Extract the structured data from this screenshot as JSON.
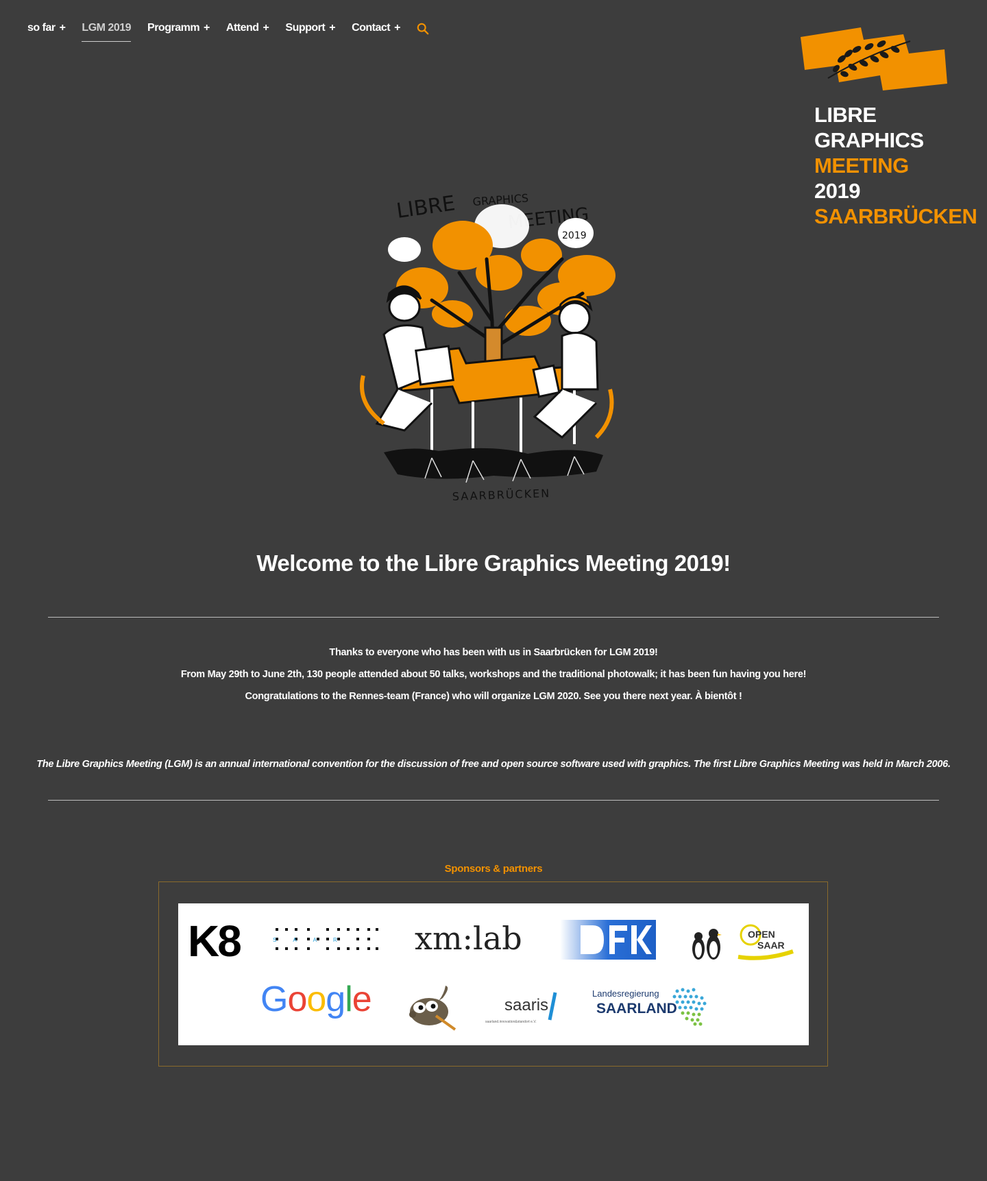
{
  "nav": {
    "items": [
      {
        "label": "so far",
        "plus": "+"
      },
      {
        "label": "LGM 2019",
        "plus": ""
      },
      {
        "label": "Programm",
        "plus": "+"
      },
      {
        "label": "Attend",
        "plus": "+"
      },
      {
        "label": "Support",
        "plus": "+"
      },
      {
        "label": "Contact",
        "plus": "+"
      }
    ],
    "search_icon": "search-icon"
  },
  "logo": {
    "line1": "LIBRE GRAPHICS",
    "line2_orange": "MEETING",
    "line2_white": "2019",
    "line3": "SAARBRÜCKEN"
  },
  "hero": {
    "title1": "LIBRE",
    "title2": "GRAPHICS",
    "title3": "MEETING",
    "year": "2019",
    "city": "SAARBRÜCKEN"
  },
  "welcome": "Welcome to the Libre Graphics Meeting 2019!",
  "thanks": {
    "line1": "Thanks to everyone who has been with us in Saarbrücken for LGM 2019!",
    "line2": "From May 29th to June 2th, 130 people attended about 50 talks, workshops and the traditional photowalk; it has been fun having you here!",
    "line3": "Congratulations to the Rennes-team (France) who will organize LGM 2020. See you there next year. À bientôt !"
  },
  "intro": "The Libre Graphics Meeting (LGM) is an annual international convention for the discussion of free and open source software used with graphics. The first Libre Graphics Meeting was held in March 2006.",
  "sponsors": {
    "title": "Sponsors & partners",
    "k8": "K8",
    "hbk_letters": "SAAR",
    "xmlab": "xm:lab",
    "opensaar_top": "OPEN",
    "opensaar_bottom": "SAAR",
    "google": [
      "G",
      "o",
      "o",
      "g",
      "l",
      "e"
    ],
    "saaris": "saaris",
    "saaris_sub": "saarland.innovation&standort e.V.",
    "saarland_top": "Landesregierung",
    "saarland_bottom": "SAARLAND"
  },
  "colors": {
    "background": "#3d3d3d",
    "accent": "#f29100",
    "text": "#ffffff"
  }
}
